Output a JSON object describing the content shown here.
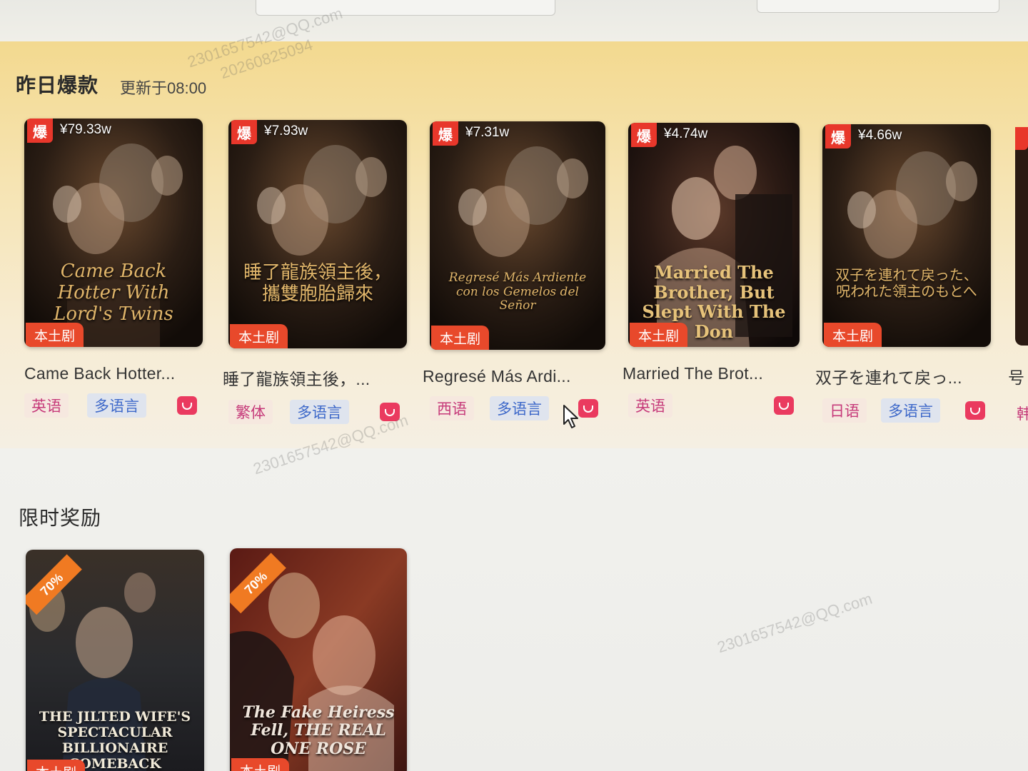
{
  "hot": {
    "title": "昨日爆款",
    "updated": "更新于08:00",
    "items": [
      {
        "badge": "爆",
        "price": "¥79.33w",
        "label": "本土剧",
        "cover_text": "Came Back Hotter With Lord's Twins",
        "name": "Came Back Hotter...",
        "lang": "英语",
        "multi": "多语言"
      },
      {
        "badge": "爆",
        "price": "¥7.93w",
        "label": "本土剧",
        "cover_text": "睡了龍族領主後，攜雙胞胎歸來",
        "name": "睡了龍族領主後，...",
        "lang": "繁体",
        "multi": "多语言"
      },
      {
        "badge": "爆",
        "price": "¥7.31w",
        "label": "本土剧",
        "cover_text": "Regresé Más Ardiente con los Gemelos del Señor",
        "name": "Regresé Más Ardi...",
        "lang": "西语",
        "multi": "多语言"
      },
      {
        "badge": "爆",
        "price": "¥4.74w",
        "label": "本土剧",
        "cover_text": "Married The Brother, But Slept With The Don",
        "name": "Married The Brot...",
        "lang": "英语",
        "multi": ""
      },
      {
        "badge": "爆",
        "price": "¥4.66w",
        "label": "本土剧",
        "cover_text": "双子を連れて戻った、呪われた領主のもとへ",
        "name": "双子を連れて戻っ...",
        "lang": "日语",
        "multi": "多语言"
      }
    ],
    "partial_next_name": "号",
    "partial_next_lang": "韩"
  },
  "reward": {
    "title": "限时奖励",
    "items": [
      {
        "discount": "70%",
        "label": "本土剧",
        "cover_text": "THE JILTED WIFE'S SPECTACULAR BILLIONAIRE COMEBACK"
      },
      {
        "discount": "70%",
        "label": "本土剧",
        "cover_text": "The Fake Heiress Fell, THE REAL ONE ROSE"
      }
    ]
  },
  "watermark": {
    "email": "2301657542@QQ.com",
    "id": "20260825094"
  },
  "colors": {
    "hot_badge": "#e8372b",
    "local_tag": "#e8492b",
    "primary_lang": "#c63a7a",
    "multi_lang": "#3d68c9",
    "fav": "#ea3a5f",
    "promo": "#f07a22"
  },
  "icons": [
    "favorite-icon",
    "mouse-cursor-icon"
  ]
}
